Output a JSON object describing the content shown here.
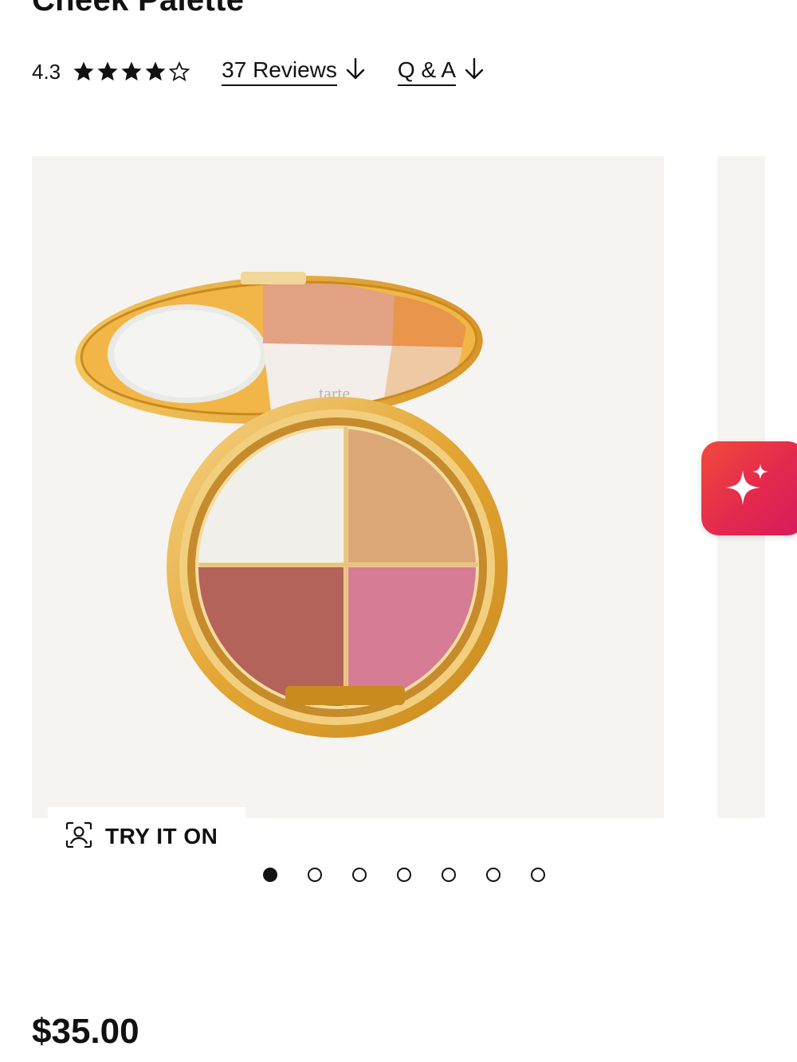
{
  "product": {
    "title": "Cheek Palette",
    "rating": "4.3",
    "stars": 4.3,
    "reviews_link": "37 Reviews",
    "qa_link": "Q & A",
    "price": "$35.00",
    "brand_imprint": "tarte"
  },
  "gallery": {
    "try_on_label": "TRY IT ON",
    "dots": [
      true,
      false,
      false,
      false,
      false,
      false,
      false
    ]
  },
  "colors": {
    "accent_gradient_start": "#f04a3a",
    "accent_gradient_end": "#d71a5c",
    "image_bg": "#f6f4f1"
  },
  "icons": {
    "reviews_arrow": "arrow-down-icon",
    "qa_arrow": "arrow-down-icon",
    "ai_button": "sparkle-icon",
    "try_on": "face-scan-icon"
  }
}
